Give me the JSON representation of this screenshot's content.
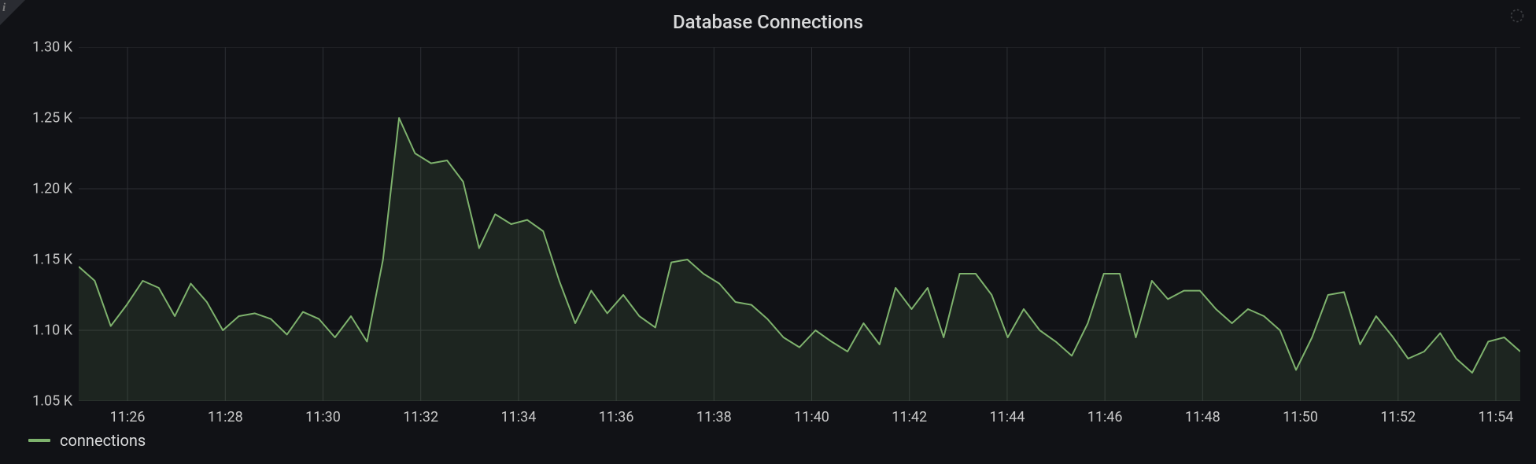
{
  "panel": {
    "title": "Database Connections"
  },
  "legend": {
    "series_label": "connections"
  },
  "axes": {
    "y_ticks": [
      "1.05 K",
      "1.10 K",
      "1.15 K",
      "1.20 K",
      "1.25 K",
      "1.30 K"
    ],
    "y_values": [
      1050,
      1100,
      1150,
      1200,
      1250,
      1300
    ],
    "x_ticks": [
      "11:26",
      "11:28",
      "11:30",
      "11:32",
      "11:34",
      "11:36",
      "11:38",
      "11:40",
      "11:42",
      "11:44",
      "11:46",
      "11:48",
      "11:50",
      "11:52",
      "11:54"
    ]
  },
  "chart_data": {
    "type": "line",
    "title": "Database Connections",
    "xlabel": "",
    "ylabel": "",
    "ylim": [
      1050,
      1300
    ],
    "x_range": [
      "11:25",
      "11:54.5"
    ],
    "series": [
      {
        "name": "connections",
        "color": "#7eb26d",
        "values": [
          1145,
          1135,
          1103,
          1118,
          1135,
          1130,
          1110,
          1133,
          1120,
          1100,
          1110,
          1112,
          1108,
          1097,
          1113,
          1108,
          1095,
          1110,
          1092,
          1150,
          1250,
          1225,
          1218,
          1220,
          1205,
          1158,
          1182,
          1175,
          1178,
          1170,
          1135,
          1105,
          1128,
          1112,
          1125,
          1110,
          1102,
          1148,
          1150,
          1140,
          1133,
          1120,
          1118,
          1108,
          1095,
          1088,
          1100,
          1092,
          1085,
          1105,
          1090,
          1130,
          1115,
          1130,
          1095,
          1140,
          1140,
          1125,
          1095,
          1115,
          1100,
          1092,
          1082,
          1105,
          1140,
          1140,
          1095,
          1135,
          1122,
          1128,
          1128,
          1115,
          1105,
          1115,
          1110,
          1100,
          1072,
          1095,
          1125,
          1127,
          1090,
          1110,
          1096,
          1080,
          1085,
          1098,
          1080,
          1070,
          1092,
          1095,
          1085
        ]
      }
    ],
    "x_tick_labels": [
      "11:26",
      "11:28",
      "11:30",
      "11:32",
      "11:34",
      "11:36",
      "11:38",
      "11:40",
      "11:42",
      "11:44",
      "11:46",
      "11:48",
      "11:50",
      "11:52",
      "11:54"
    ]
  }
}
